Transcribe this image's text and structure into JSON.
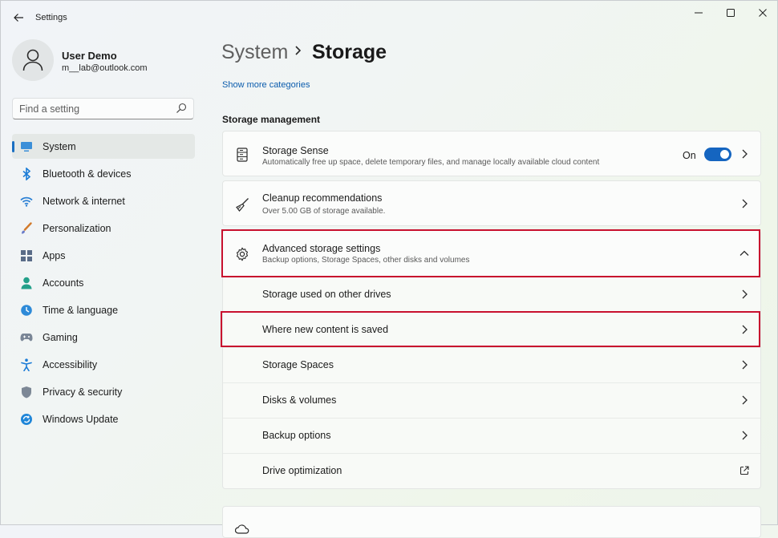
{
  "app": {
    "title": "Settings"
  },
  "profile": {
    "name": "User Demo",
    "email": "m__lab@outlook.com"
  },
  "search": {
    "placeholder": "Find a setting"
  },
  "nav": {
    "items": [
      {
        "label": "System",
        "icon": "monitor-icon",
        "selected": true
      },
      {
        "label": "Bluetooth & devices",
        "icon": "bluetooth-icon"
      },
      {
        "label": "Network & internet",
        "icon": "wifi-icon"
      },
      {
        "label": "Personalization",
        "icon": "brush-icon"
      },
      {
        "label": "Apps",
        "icon": "apps-icon"
      },
      {
        "label": "Accounts",
        "icon": "person-icon"
      },
      {
        "label": "Time & language",
        "icon": "globe-clock-icon"
      },
      {
        "label": "Gaming",
        "icon": "gamepad-icon"
      },
      {
        "label": "Accessibility",
        "icon": "accessibility-icon"
      },
      {
        "label": "Privacy & security",
        "icon": "shield-icon"
      },
      {
        "label": "Windows Update",
        "icon": "update-icon"
      }
    ]
  },
  "breadcrumb": {
    "parent": "System",
    "current": "Storage"
  },
  "show_more": "Show more categories",
  "section": {
    "title": "Storage management"
  },
  "cards": {
    "storage_sense": {
      "title": "Storage Sense",
      "subtitle": "Automatically free up space, delete temporary files, and manage locally available cloud content",
      "toggle_label": "On",
      "toggle_on": true
    },
    "cleanup": {
      "title": "Cleanup recommendations",
      "subtitle": "Over 5.00 GB of storage available."
    },
    "advanced": {
      "title": "Advanced storage settings",
      "subtitle": "Backup options, Storage Spaces, other disks and volumes",
      "expanded": true
    }
  },
  "advanced_items": [
    {
      "label": "Storage used on other drives",
      "icon": "chevron-right-icon"
    },
    {
      "label": "Where new content is saved",
      "icon": "chevron-right-icon"
    },
    {
      "label": "Storage Spaces",
      "icon": "chevron-right-icon"
    },
    {
      "label": "Disks & volumes",
      "icon": "chevron-right-icon"
    },
    {
      "label": "Backup options",
      "icon": "chevron-right-icon"
    },
    {
      "label": "Drive optimization",
      "icon": "external-link-icon"
    }
  ],
  "colors": {
    "accent": "#1565c0",
    "highlight": "#c8102e"
  }
}
